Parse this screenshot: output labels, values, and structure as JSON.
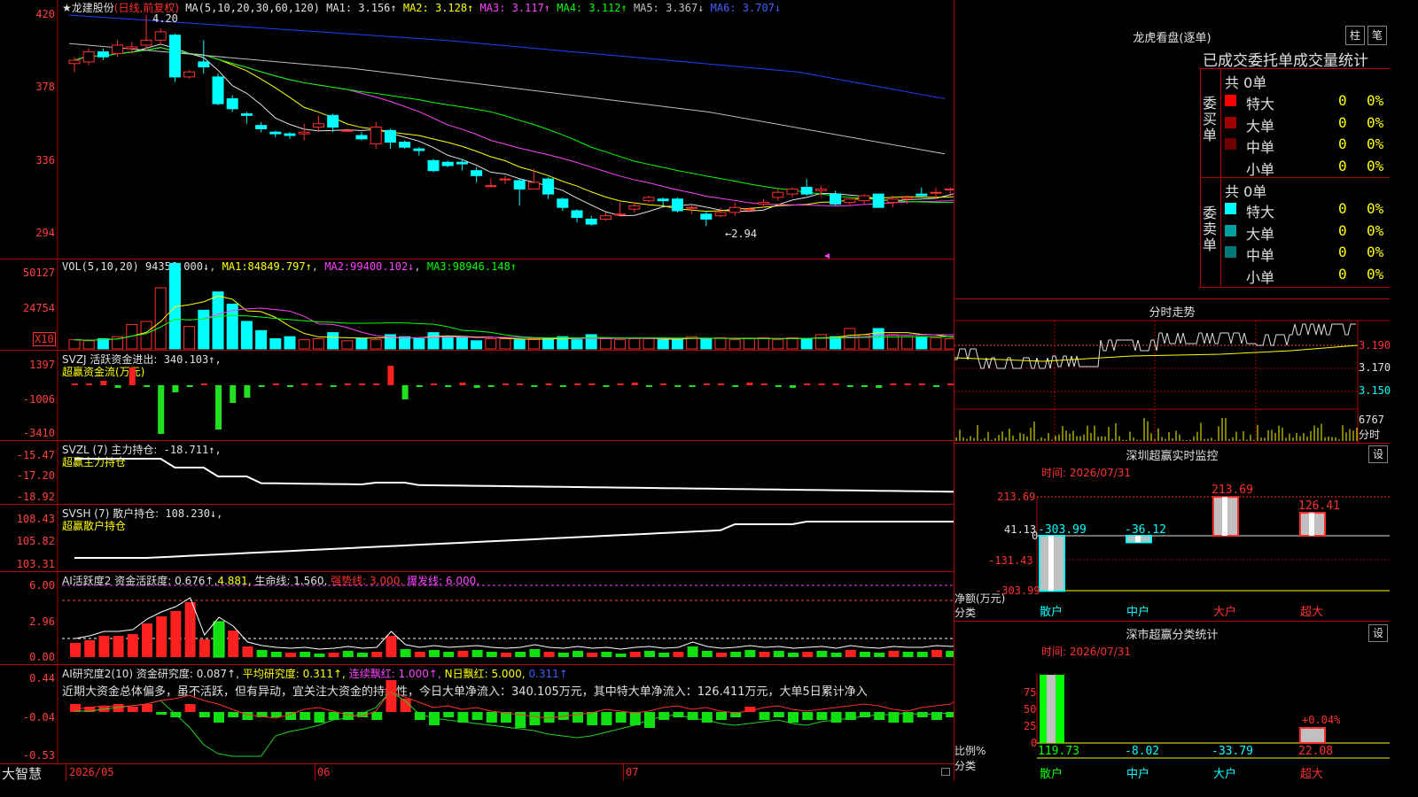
{
  "stock": {
    "name": "★龙建股份",
    "period": "(日线,前复权)"
  },
  "price_pane": {
    "ma_title": "MA(5,10,20,30,60,120)",
    "ma": [
      {
        "label": "MA1:",
        "value": "3.156↑",
        "color": "#e0e0e0"
      },
      {
        "label": "MA2:",
        "value": "3.128↑",
        "color": "#ffff00"
      },
      {
        "label": "MA3:",
        "value": "3.117↑",
        "color": "#ff40ff"
      },
      {
        "label": "MA4:",
        "value": "3.112↑",
        "color": "#00ff00"
      },
      {
        "label": "MA5:",
        "value": "3.367↓",
        "color": "#c0c0c0"
      },
      {
        "label": "MA6:",
        "value": "3.707↓",
        "color": "#4060ff"
      }
    ],
    "y_ticks": [
      "420",
      "378",
      "336",
      "294"
    ],
    "high_mark": "4.20",
    "low_mark": "←2.94"
  },
  "vol_pane": {
    "title": "VOL(5,10,20)",
    "value": "94356.000↓",
    "ma": [
      {
        "label": "MA1:",
        "value": "84849.797↑"
      },
      {
        "label": "MA2:",
        "value": "99400.102↓"
      },
      {
        "label": "MA3:",
        "value": "98946.148↑"
      }
    ],
    "y_ticks": [
      "50127",
      "24754"
    ],
    "unit": "X10"
  },
  "svzj_pane": {
    "title": "SVZJ  活跃资金进出:",
    "value": "340.103↑,",
    "subtitle": "超赢资金流(万元)",
    "y_ticks": [
      "1397",
      "-1006",
      "-3410"
    ]
  },
  "svzl_pane": {
    "title": "SVZL (7) 主力持仓:",
    "value": "-18.711↑,",
    "subtitle": "超赢主力持仓",
    "y_ticks": [
      "-15.47",
      "-17.20",
      "-18.92"
    ]
  },
  "svsh_pane": {
    "title": "SVSH (7) 散户持仓:",
    "value": "108.230↓,",
    "subtitle": "超赢散户持仓",
    "y_ticks": [
      "108.43",
      "105.82",
      "103.31"
    ]
  },
  "ai1_pane": {
    "title": "AI活跃度2 资金活跃度:",
    "v1": "0.676↑,",
    "v2": "4.881,",
    "life": "生命线: 1.560,",
    "strong": "强势线: 3.000,",
    "burst": "爆发线: 6.000,",
    "y_ticks": [
      "6.00",
      "2.96",
      "0.00"
    ]
  },
  "ai2_pane": {
    "title": "AI研究度2(10) 资金研究度:",
    "v1": "0.087↑,",
    "avg": "平均研究度: 0.311↑,",
    "cont": "连续飘红: 1.000↑,",
    "nday": "N日飘红: 5.000,",
    "last": "0.311↑",
    "comment": "近期大资金总体偏多，虽不活跃，但有异动，宜关注大资金的持续性，今日大单净流入：340.105万元，其中特大单净流入：126.411万元，大单5日累计净入",
    "y_ticks": [
      "0.44",
      "-0.04",
      "-0.53"
    ]
  },
  "bottom_bar": {
    "brand": "大智慧",
    "dates": [
      "2026/05",
      "06",
      "07"
    ]
  },
  "right": {
    "lhb_title": "龙虎看盘(逐单)",
    "btn1": "柱",
    "btn2": "笔",
    "tabs": "已成交委托单成交量统计",
    "buy": {
      "side": "委买单",
      "total": "共 0单",
      "rows": [
        {
          "k": "特大",
          "v": "0",
          "p": "0%",
          "c": "#ff0000"
        },
        {
          "k": "大单",
          "v": "0",
          "p": "0%",
          "c": "#a00000"
        },
        {
          "k": "中单",
          "v": "0",
          "p": "0%",
          "c": "#700000"
        },
        {
          "k": "小单",
          "v": "0",
          "p": "0%",
          "c": "#000000"
        }
      ]
    },
    "sell": {
      "side": "委卖单",
      "total": "共 0单",
      "rows": [
        {
          "k": "特大",
          "v": "0",
          "p": "0%",
          "c": "#00ffff"
        },
        {
          "k": "大单",
          "v": "0",
          "p": "0%",
          "c": "#00a0a0"
        },
        {
          "k": "中单",
          "v": "0",
          "p": "0%",
          "c": "#007878"
        },
        {
          "k": "小单",
          "v": "0",
          "p": "0%",
          "c": "#000000"
        }
      ]
    },
    "intraday": {
      "title": "分时走势",
      "y": [
        "3.190",
        "3.170",
        "3.150"
      ],
      "vol": "6767",
      "vol_label": "分时"
    },
    "monitor": {
      "title": "深圳超赢实时监控",
      "set": "设",
      "time": "时间: 2026/07/31",
      "y": [
        "213.69",
        "41.13",
        "0",
        "-131.43",
        "-303.99"
      ],
      "ylabel1": "净额(万元)",
      "ylabel2": "分类",
      "bars": [
        {
          "cat": "散户",
          "val": "-303.99"
        },
        {
          "cat": "中户",
          "val": "-36.12"
        },
        {
          "cat": "大户",
          "val": "213.69"
        },
        {
          "cat": "超大",
          "val": "126.41"
        }
      ]
    },
    "classify": {
      "title": "深市超赢分类统计",
      "set": "设",
      "time": "时间: 2026/07/31",
      "y": [
        "75",
        "50",
        "25",
        "0"
      ],
      "ylabel1": "比例%",
      "ylabel2": "分类",
      "bars": [
        {
          "cat": "散户",
          "val": "119.73"
        },
        {
          "cat": "中户",
          "val": "-8.02"
        },
        {
          "cat": "大户",
          "val": "-33.79"
        },
        {
          "cat": "超大",
          "val": "22.08"
        }
      ],
      "ann": "+0.04%"
    }
  },
  "chart_data": {
    "type": "candlestick",
    "title": "龙建股份 (日线,前复权)",
    "ylim": [
      2.94,
      4.2
    ],
    "candles": [
      [
        3.91,
        3.93,
        3.86,
        3.95
      ],
      [
        3.92,
        3.98,
        3.9,
        4.0
      ],
      [
        3.98,
        3.95,
        3.93,
        4.0
      ],
      [
        3.97,
        4.02,
        3.95,
        4.05
      ],
      [
        4.0,
        4.01,
        3.97,
        4.04
      ],
      [
        4.02,
        4.05,
        4.0,
        4.2
      ],
      [
        4.05,
        4.1,
        4.02,
        4.12
      ],
      [
        4.08,
        3.83,
        3.8,
        4.09
      ],
      [
        3.83,
        3.86,
        3.82,
        3.87
      ],
      [
        3.92,
        3.89,
        3.85,
        4.05
      ],
      [
        3.83,
        3.67,
        3.66,
        3.85
      ],
      [
        3.7,
        3.64,
        3.62,
        3.72
      ],
      [
        3.61,
        3.6,
        3.55,
        3.62
      ],
      [
        3.54,
        3.52,
        3.5,
        3.56
      ],
      [
        3.5,
        3.49,
        3.47,
        3.51
      ],
      [
        3.49,
        3.48,
        3.46,
        3.5
      ],
      [
        3.49,
        3.5,
        3.45,
        3.55
      ],
      [
        3.53,
        3.55,
        3.5,
        3.6
      ],
      [
        3.6,
        3.53,
        3.5,
        3.61
      ],
      [
        3.51,
        3.51,
        3.5,
        3.52
      ],
      [
        3.48,
        3.46,
        3.45,
        3.5
      ],
      [
        3.43,
        3.53,
        3.4,
        3.56
      ],
      [
        3.51,
        3.44,
        3.4,
        3.52
      ],
      [
        3.44,
        3.41,
        3.4,
        3.45
      ],
      [
        3.4,
        3.39,
        3.36,
        3.41
      ],
      [
        3.33,
        3.27,
        3.26,
        3.34
      ],
      [
        3.32,
        3.3,
        3.29,
        3.33
      ],
      [
        3.32,
        3.31,
        3.27,
        3.34
      ],
      [
        3.27,
        3.24,
        3.2,
        3.29
      ],
      [
        3.18,
        3.18,
        3.17,
        3.22
      ],
      [
        3.22,
        3.22,
        3.19,
        3.24
      ],
      [
        3.21,
        3.16,
        3.06,
        3.22
      ],
      [
        3.16,
        3.2,
        3.16,
        3.28
      ],
      [
        3.22,
        3.13,
        3.1,
        3.23
      ],
      [
        3.1,
        3.05,
        3.03,
        3.11
      ],
      [
        3.03,
        2.99,
        2.96,
        3.04
      ],
      [
        2.98,
        2.95,
        2.94,
        3.0
      ],
      [
        2.98,
        3.0,
        2.97,
        3.02
      ],
      [
        3.01,
        3.01,
        3.0,
        3.08
      ],
      [
        3.04,
        3.06,
        3.02,
        3.08
      ],
      [
        3.09,
        3.11,
        3.08,
        3.12
      ],
      [
        3.1,
        3.09,
        3.06,
        3.11
      ],
      [
        3.1,
        3.03,
        3.02,
        3.11
      ],
      [
        3.05,
        3.05,
        3.01,
        3.06
      ],
      [
        3.01,
        2.98,
        2.94,
        3.03
      ],
      [
        3.0,
        3.02,
        2.99,
        3.05
      ],
      [
        3.02,
        3.05,
        3.0,
        3.08
      ],
      [
        3.04,
        3.04,
        3.02,
        3.05
      ],
      [
        3.07,
        3.08,
        3.05,
        3.1
      ],
      [
        3.11,
        3.14,
        3.09,
        3.16
      ],
      [
        3.13,
        3.16,
        3.11,
        3.17
      ],
      [
        3.17,
        3.13,
        3.12,
        3.22
      ],
      [
        3.15,
        3.16,
        3.12,
        3.18
      ],
      [
        3.13,
        3.07,
        3.06,
        3.15
      ],
      [
        3.08,
        3.1,
        3.06,
        3.1
      ],
      [
        3.09,
        3.12,
        3.07,
        3.13
      ],
      [
        3.13,
        3.05,
        3.05,
        3.13
      ],
      [
        3.08,
        3.1,
        3.05,
        3.12
      ],
      [
        3.1,
        3.11,
        3.07,
        3.12
      ],
      [
        3.13,
        3.12,
        3.11,
        3.17
      ],
      [
        3.14,
        3.14,
        3.1,
        3.17
      ],
      [
        3.16,
        3.16,
        3.12,
        3.17
      ],
      [
        3.16,
        3.21,
        3.15,
        3.21
      ]
    ]
  }
}
